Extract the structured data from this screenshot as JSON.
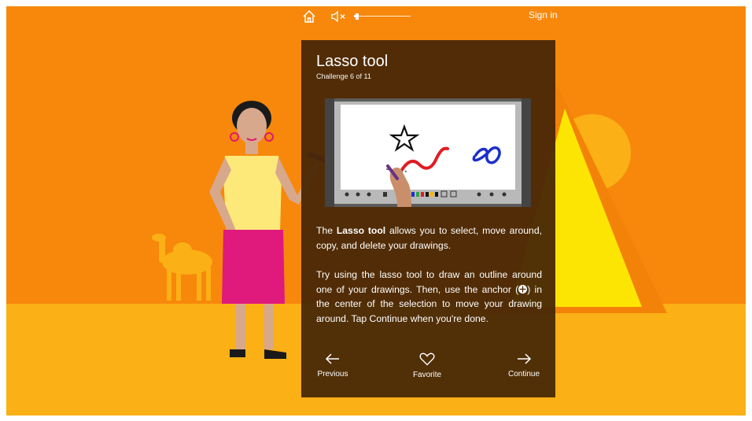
{
  "topbar": {
    "home_icon": "home-icon",
    "mute_icon": "speaker-muted-icon",
    "volume_level": 0.05,
    "signin_label": "Sign in"
  },
  "card": {
    "title": "Lasso tool",
    "subtitle": "Challenge 6 of 11",
    "para1_prefix": "The ",
    "para1_bold": "Lasso tool",
    "para1_suffix": " allows you to select, move around, copy, and delete your drawings.",
    "para2_before": "Try using the lasso tool to draw an outline around one of your drawings. Then, use the anchor (",
    "para2_after": ") in the center of the selection to move your drawing around. Tap Continue when you're done."
  },
  "nav": {
    "previous_label": "Previous",
    "favorite_label": "Favorite",
    "continue_label": "Continue"
  },
  "colors": {
    "background": "#f7880b",
    "ground": "#fbb015",
    "card": "#462606"
  }
}
